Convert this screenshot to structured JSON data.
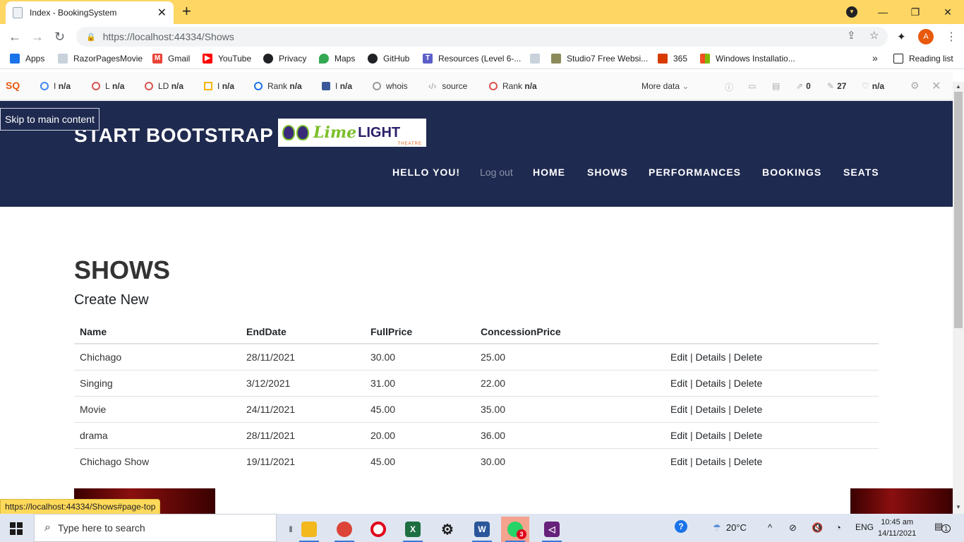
{
  "browser": {
    "tab_title": "Index - BookingSystem",
    "url_prefix": "https://localhost",
    "url_rest": ":44334/Shows",
    "profile_initial": "A"
  },
  "bookmarks": [
    {
      "label": "Apps",
      "icon": "apps-grid-icon",
      "color": "#1a73e8"
    },
    {
      "label": "RazorPagesMovie",
      "icon": "page-icon",
      "color": "#9aa6b4"
    },
    {
      "label": "Gmail",
      "icon": "gmail-icon",
      "color": "#ea4335"
    },
    {
      "label": "YouTube",
      "icon": "youtube-icon",
      "color": "#ff0000"
    },
    {
      "label": "Privacy",
      "icon": "globe-icon",
      "color": "#202124"
    },
    {
      "label": "Maps",
      "icon": "maps-pin-icon",
      "color": "#34a853"
    },
    {
      "label": "GitHub",
      "icon": "github-icon",
      "color": "#202124"
    },
    {
      "label": "Resources (Level 6-...",
      "icon": "teams-icon",
      "color": "#5b5fc7"
    },
    {
      "label": "",
      "icon": "page-icon",
      "color": "#9aa6b4"
    },
    {
      "label": "Studio7 Free Websi...",
      "icon": "studio7-icon",
      "color": "#8a8a5a"
    },
    {
      "label": "365",
      "icon": "office-icon",
      "color": "#d83b01"
    },
    {
      "label": "Windows Installatio...",
      "icon": "windows-icon",
      "color": "#00a4ef"
    }
  ],
  "bookmarks_overflow": "»",
  "reading_list": "Reading list",
  "seo": {
    "items": [
      {
        "prefix": "I",
        "value": "n/a",
        "icon": "google-icon"
      },
      {
        "prefix": "L",
        "value": "n/a",
        "icon": "circle-icon"
      },
      {
        "prefix": "LD",
        "value": "n/a",
        "icon": "circle-icon"
      },
      {
        "prefix": "I",
        "value": "n/a",
        "icon": "bing-icon"
      },
      {
        "prefix": "Rank",
        "value": "n/a",
        "icon": "alexa-icon"
      },
      {
        "prefix": "I",
        "value": "n/a",
        "icon": "facebook-icon"
      },
      {
        "prefix": "whois",
        "value": "",
        "icon": "person-icon"
      },
      {
        "prefix": "source",
        "value": "",
        "icon": "code-icon"
      },
      {
        "prefix": "Rank",
        "value": "n/a",
        "icon": "circle-icon"
      }
    ],
    "more": "More data",
    "count_links": "0",
    "count_pages": "27",
    "count_hearts": "n/a"
  },
  "site": {
    "skip_link": "Skip to main content",
    "brand": "START BOOTSTRAP",
    "logo": {
      "lime": "Lime",
      "light": "LIGHT",
      "sub": "THEATRE"
    },
    "nav": {
      "hello": "HELLO YOU!",
      "logout": "Log out",
      "home": "HOME",
      "shows": "SHOWS",
      "performances": "PERFORMANCES",
      "bookings": "BOOKINGS",
      "seats": "SEATS"
    },
    "heading": "SHOWS",
    "create_new": "Create New",
    "columns": [
      "Name",
      "EndDate",
      "FullPrice",
      "ConcessionPrice"
    ],
    "rows": [
      {
        "name": "Chichago",
        "end": "28/11/2021",
        "full": "30.00",
        "conc": "25.00"
      },
      {
        "name": "Singing",
        "end": "3/12/2021",
        "full": "31.00",
        "conc": "22.00"
      },
      {
        "name": "Movie",
        "end": "24/11/2021",
        "full": "45.00",
        "conc": "35.00"
      },
      {
        "name": "drama",
        "end": "28/11/2021",
        "full": "20.00",
        "conc": "36.00"
      },
      {
        "name": "Chichago Show",
        "end": "19/11/2021",
        "full": "45.00",
        "conc": "30.00"
      }
    ],
    "actions": {
      "edit": "Edit",
      "details": "Details",
      "delete": "Delete",
      "sep": "|"
    }
  },
  "status_url": "https://localhost:44334/Shows#page-top",
  "taskbar": {
    "search_placeholder": "Type here to search",
    "weather": "20°C",
    "lang": "ENG",
    "time": "10:45 am",
    "date": "14/11/2021",
    "whatsapp_badge": "3",
    "notif_badge": "1"
  }
}
